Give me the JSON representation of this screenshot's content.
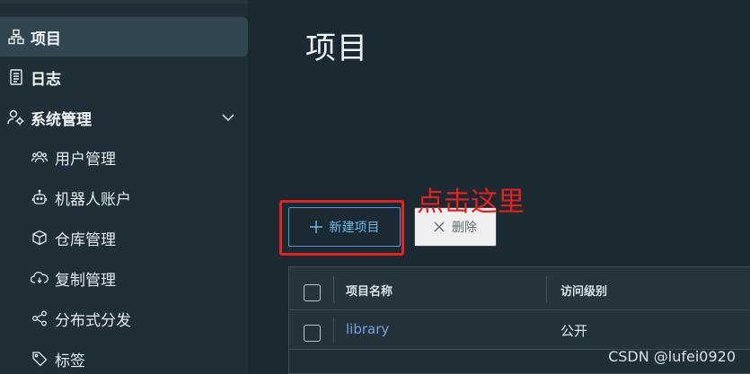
{
  "sidebar": {
    "items": [
      {
        "label": "项目",
        "icon": "project-icon",
        "active": true
      },
      {
        "label": "日志",
        "icon": "log-icon"
      },
      {
        "label": "系统管理",
        "icon": "system-admin-icon",
        "expanded": true
      }
    ],
    "subitems": [
      {
        "label": "用户管理",
        "icon": "users-icon"
      },
      {
        "label": "机器人账户",
        "icon": "robot-icon"
      },
      {
        "label": "仓库管理",
        "icon": "registry-icon"
      },
      {
        "label": "复制管理",
        "icon": "replication-icon"
      },
      {
        "label": "分布式分发",
        "icon": "distribution-icon"
      },
      {
        "label": "标签",
        "icon": "tag-icon"
      }
    ]
  },
  "main": {
    "title": "项目",
    "buttons": {
      "new_project": "新建项目",
      "delete": "删除"
    },
    "annotation": "点击这里",
    "table": {
      "columns": [
        "项目名称",
        "访问级别"
      ],
      "rows": [
        {
          "name": "library",
          "access": "公开"
        }
      ]
    }
  },
  "watermark": "CSDN @lufei0920",
  "colors": {
    "accent": "#4a9fd6",
    "annotation": "#e8201b",
    "link": "#7b9fe3"
  }
}
